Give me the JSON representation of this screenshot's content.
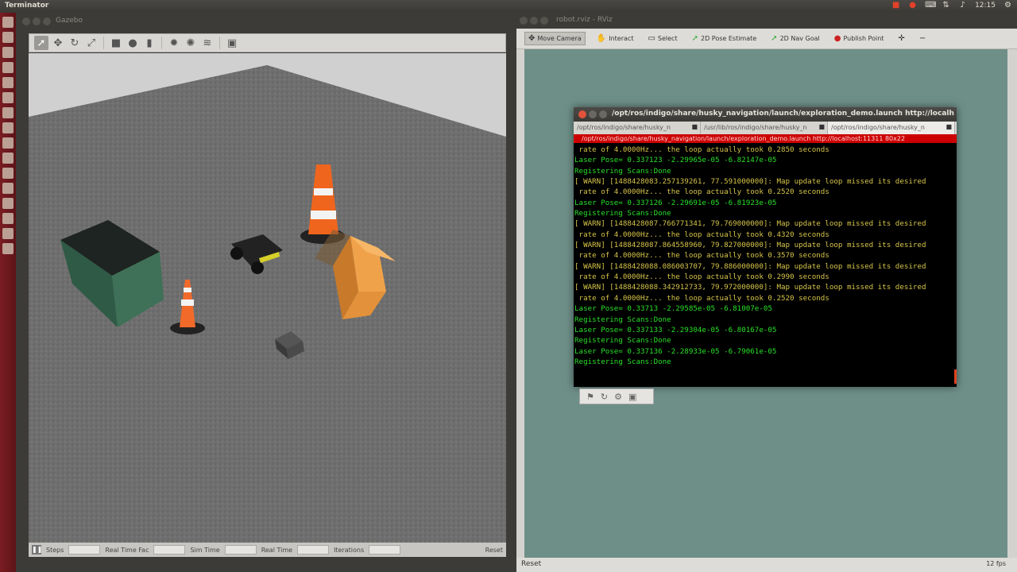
{
  "top_panel": {
    "app_title": "Terminator",
    "clock": "12:15",
    "icons": [
      "camera-icon",
      "firefox-icon",
      "keyboard-icon",
      "volume-icon",
      "gear-icon"
    ]
  },
  "gazebo": {
    "title": "Gazebo",
    "status": {
      "steps_label": "Steps",
      "real_time_factor_label": "Real Time Fac",
      "sim_time_label": "Sim Time",
      "real_time_label": "Real Time",
      "iterations_label": "Iterations",
      "reset_label": "Reset"
    }
  },
  "rviz": {
    "title": "robot.rviz - RViz",
    "tools": [
      "Move Camera",
      "Interact",
      "Select",
      "2D Pose Estimate",
      "2D Nav Goal",
      "Publish Point"
    ],
    "reset_label": "Reset",
    "fps": "12 fps"
  },
  "terminal": {
    "title": "/opt/ros/indigo/share/husky_navigation/launch/exploration_demo.launch http://localh",
    "tabs": [
      "/opt/ros/indigo/share/husky_n",
      "/usr/lib/ros/indigo/share/husky_n",
      "/opt/ros/indigo/share/husky_n"
    ],
    "active_path": "/opt/ros/indigo/share/husky_navigation/launch/exploration_demo.launch http://localhost:11311 80x22",
    "lines": [
      {
        "text": " rate of 4.0000Hz... the loop actually took 0.2850 seconds",
        "kind": "warn"
      },
      {
        "text": "Laser Pose= 0.337123 -2.29965e-05 -6.82147e-05",
        "kind": "info"
      },
      {
        "text": "Registering Scans:Done",
        "kind": "info"
      },
      {
        "text": "[ WARN] [1488428083.257139261, 77.591000000]: Map update loop missed its desired",
        "kind": "warn"
      },
      {
        "text": " rate of 4.0000Hz... the loop actually took 0.2520 seconds",
        "kind": "warn"
      },
      {
        "text": "Laser Pose= 0.337126 -2.29691e-05 -6.81923e-05",
        "kind": "info"
      },
      {
        "text": "Registering Scans:Done",
        "kind": "info"
      },
      {
        "text": "[ WARN] [1488428087.766771341, 79.769000000]: Map update loop missed its desired",
        "kind": "warn"
      },
      {
        "text": " rate of 4.0000Hz... the loop actually took 0.4320 seconds",
        "kind": "warn"
      },
      {
        "text": "[ WARN] [1488428087.864558960, 79.827000000]: Map update loop missed its desired",
        "kind": "warn"
      },
      {
        "text": " rate of 4.0000Hz... the loop actually took 0.3570 seconds",
        "kind": "warn"
      },
      {
        "text": "[ WARN] [1488428088.086003707, 79.886000000]: Map update loop missed its desired",
        "kind": "warn"
      },
      {
        "text": " rate of 4.0000Hz... the loop actually took 0.2990 seconds",
        "kind": "warn"
      },
      {
        "text": "[ WARN] [1488428088.342912733, 79.972000000]: Map update loop missed its desired",
        "kind": "warn"
      },
      {
        "text": " rate of 4.0000Hz... the loop actually took 0.2520 seconds",
        "kind": "warn"
      },
      {
        "text": "Laser Pose= 0.33713 -2.29585e-05 -6.81007e-05",
        "kind": "info"
      },
      {
        "text": "Registering Scans:Done",
        "kind": "info"
      },
      {
        "text": "Laser Pose= 0.337133 -2.29304e-05 -6.80167e-05",
        "kind": "info"
      },
      {
        "text": "Registering Scans:Done",
        "kind": "info"
      },
      {
        "text": "Laser Pose= 0.337136 -2.28933e-05 -6.79061e-05",
        "kind": "info"
      },
      {
        "text": "Registering Scans:Done",
        "kind": "info"
      }
    ]
  }
}
